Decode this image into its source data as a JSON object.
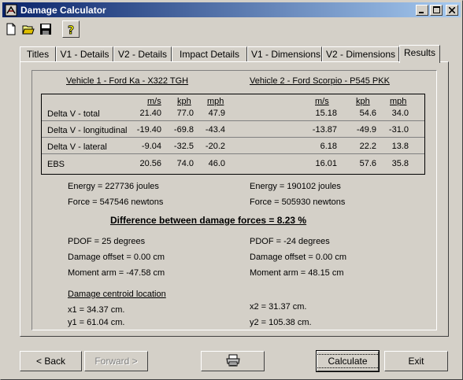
{
  "window": {
    "title": "Damage Calculator"
  },
  "toolbar": {
    "icons": [
      "new-file-icon",
      "open-folder-icon",
      "save-disk-icon",
      "help-icon"
    ]
  },
  "tabs": [
    "Titles",
    "V1 - Details",
    "V2 - Details",
    "Impact Details",
    "V1 - Dimensions",
    "V2 - Dimensions",
    "Results"
  ],
  "active_tab": "Results",
  "vehicles": {
    "v1": "Vehicle 1 - Ford Ka - X322 TGH",
    "v2": "Vehicle 2 - Ford Scorpio - P545 PKK"
  },
  "units": [
    "m/s",
    "kph",
    "mph"
  ],
  "rows": [
    {
      "label": "Delta V - total",
      "v1": [
        "21.40",
        "77.0",
        "47.9"
      ],
      "v2": [
        "15.18",
        "54.6",
        "34.0"
      ]
    },
    {
      "label": "Delta V - longitudinal",
      "v1": [
        "-19.40",
        "-69.8",
        "-43.4"
      ],
      "v2": [
        "-13.87",
        "-49.9",
        "-31.0"
      ]
    },
    {
      "label": "Delta V - lateral",
      "v1": [
        "-9.04",
        "-32.5",
        "-20.2"
      ],
      "v2": [
        "6.18",
        "22.2",
        "13.8"
      ]
    },
    {
      "label": "EBS",
      "v1": [
        "20.56",
        "74.0",
        "46.0"
      ],
      "v2": [
        "16.01",
        "57.6",
        "35.8"
      ]
    }
  ],
  "energy": {
    "v1": "Energy = 227736 joules",
    "v2": "Energy = 190102  joules"
  },
  "force": {
    "v1": "Force = 547546 newtons",
    "v2": "Force = 505930 newtons"
  },
  "difference": "Difference between damage forces = 8.23 %",
  "pdof": {
    "v1": "PDOF = 25 degrees",
    "v2": "PDOF = -24 degrees"
  },
  "damage_offset": {
    "v1": "Damage offset = 0.00 cm",
    "v2": "Damage offset = 0.00 cm"
  },
  "moment_arm": {
    "v1": "Moment arm = -47.58 cm",
    "v2": "Moment arm = 48.15 cm"
  },
  "centroid": {
    "heading": "Damage centroid location",
    "x1": "x1 = 34.37 cm.",
    "y1": "y1 = 61.04 cm.",
    "x2": "x2 = 31.37 cm.",
    "y2": "y2 = 105.38 cm."
  },
  "buttons": {
    "back": "< Back",
    "forward": "Forward >",
    "calculate": "Calculate",
    "exit": "Exit"
  }
}
